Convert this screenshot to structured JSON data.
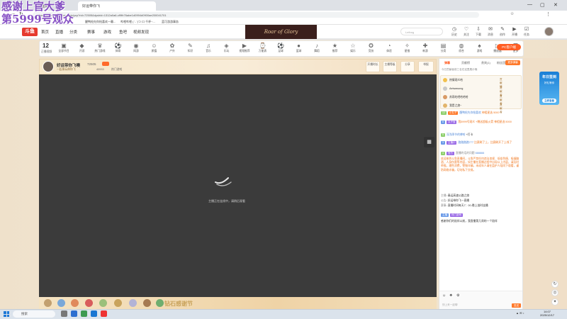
{
  "watermark": {
    "line1": "感谢上官大爹",
    "line2": "第5999号观众"
  },
  "browser": {
    "tabs": [
      {
        "title": "斗鱼直播"
      },
      {
        "title": "好运带你飞"
      }
    ],
    "url": "https://www.douyu.com/topic/yzp?rid=72505&dyshid=1312a0a6-cf9fb76abe1d0994d0900ae200041701",
    "bookmarks": [
      "醒鸭抢先你抢喜欢一幕...",
      "哔哩哔哩 ( '- ')つ ロ 千杯~...",
      "蓝可游游事务"
    ]
  },
  "site": {
    "logo": "斗鱼",
    "nav": [
      "首页",
      "直播",
      "分类",
      "赛事",
      "游戏",
      "鱼吧",
      "视频发现"
    ],
    "banner": "Roar of Glory",
    "search_placeholder": "Lethog",
    "top_icons": [
      "历史",
      "关注",
      "下载",
      "消息",
      "创作",
      "开播",
      "任务"
    ]
  },
  "categories": {
    "count": "12",
    "count_label": "正播视频",
    "items": [
      "全部节目",
      "开游",
      "热门游戏",
      "体育",
      "网游",
      "颜值",
      "户外",
      "知识",
      "音乐",
      "乐玩",
      "视频推荐",
      "万能表",
      "足球",
      "篮球",
      "舞蹈",
      "推荐",
      "娱乐",
      "竞技",
      "体验",
      "星推",
      "新游",
      "分类",
      "综合",
      "游戏",
      "播放器",
      "更多"
    ],
    "pc_button": "PC客户端"
  },
  "streamer": {
    "name": "好运带你飞噢",
    "room_id": "72505",
    "follow": "关注",
    "tag": "一起来玩带你飞",
    "heat": "40933",
    "hot_rank": "热门游戏",
    "boxes": [
      "开播时长",
      "主播等级",
      "分享",
      "客户端",
      "举报"
    ]
  },
  "video": {
    "loading_text": "主播正在连线中，请稍后观看"
  },
  "gifts": {
    "mark": "钻石感谢节"
  },
  "panel": {
    "tabs": [
      "弹幕",
      "贡献榜",
      "贵宾(1)",
      "粉丝团"
    ],
    "tab_button": "更多弹幕",
    "note": "今日贡献者前三名在这里展示哦",
    "ranks": [
      {
        "name": "热情观众哈",
        "value": "贡献值"
      },
      {
        "name": "Aeiwawong",
        "value": "贡献者"
      },
      {
        "name": "苏雨吃吧哈哈哈",
        "value": "贡献者"
      },
      {
        "name": "我是之旅~",
        "value": "贡献者"
      }
    ],
    "chat": [
      {
        "level": "12",
        "medal": "小丸子",
        "user": "醒鸭抢先你抢喜欢",
        "text": "神祖星选 5000"
      },
      {
        "level": "8",
        "medal": "丸子宝",
        "user": "",
        "text": "我5999号观众 +赠送超级火箭 神祖星选 5000"
      },
      {
        "level": "5",
        "medal": "",
        "user": "深浅季节的傅哈",
        "text": "+打卡"
      },
      {
        "level": "3",
        "medal": "主播小",
        "user": "路路路路777",
        "text": "比赛刷了上，比赛刷开了上线了"
      },
      {
        "level": "4",
        "medal": "官方",
        "user": "直播的话的问题",
        "text": "666666"
      }
    ],
    "notice": "欢迎来到斗鱼直播间，斗鱼严禁任何违法违规、低俗色情、吸烟酗酒、人身伤害等内容，如主播在直播过程中出现以上内容，请及时举报。理性消费，警惕诈骗，未成年人请在监护人陪同下观看，谨防网络诈骗，切勿私下交易。",
    "system": [
      {
        "label": "主播",
        "text": "春运高速公路之旅"
      },
      {
        "label": "公告",
        "text": "好运带你飞一直播"
      },
      {
        "label": "赛事",
        "text": "直播时间每天7：00-晚上准时连播"
      }
    ],
    "last_msg_tag": "主播",
    "last_msg_tag2": "热门游戏",
    "last_msg": "感谢你们的陪伴以前，我直播第几周的一个陪伴",
    "input_placeholder": "快上来一起聊",
    "send": "发送"
  },
  "ad": {
    "title": "年日签到",
    "sub": "好礼等你",
    "btn": "立即查看"
  },
  "taskbar": {
    "search": "搜索",
    "time": "14:07",
    "date": "2025/12/17"
  }
}
